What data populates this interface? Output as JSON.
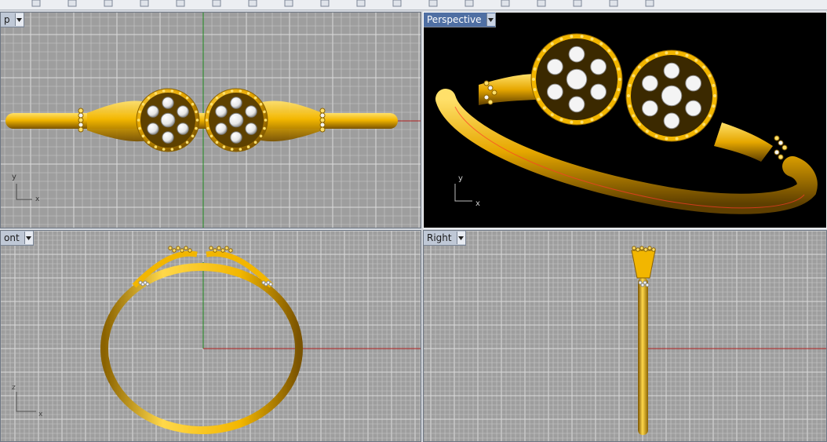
{
  "toolbar": {
    "icons": [
      "undo-icon",
      "redo-icon",
      "copy-icon",
      "paste-icon",
      "select-icon",
      "lasso-icon",
      "pan-icon",
      "rotate-icon",
      "zoom-icon",
      "zoom-window-icon",
      "zoom-extents-icon",
      "zoom-selected-icon",
      "shade-icon",
      "render-icon",
      "layer-icon",
      "properties-icon",
      "options-icon",
      "help-icon"
    ]
  },
  "viewports": {
    "top": {
      "title": "p",
      "background": "#9e9e9e",
      "axes": [
        "y",
        "x"
      ]
    },
    "perspective": {
      "title": "Perspective",
      "background": "#000000",
      "axes": [
        "y",
        "x"
      ]
    },
    "front": {
      "title": "ont",
      "background": "#9e9e9e",
      "axes": [
        "z",
        "x"
      ]
    },
    "right": {
      "title": "Right",
      "background": "#9e9e9e",
      "axes": [
        "z",
        "y"
      ]
    }
  },
  "colors": {
    "gold": "#f2b600",
    "gold_dark": "#8a6200",
    "gold_light": "#ffe06a",
    "gem": "#f4f4f4",
    "grid_line": "#c9c9c9",
    "grid_major": "#dcdcdc",
    "axis_x": "#b22222",
    "axis_y": "#1f8a1f",
    "active_tab": "#4f6fa3"
  }
}
